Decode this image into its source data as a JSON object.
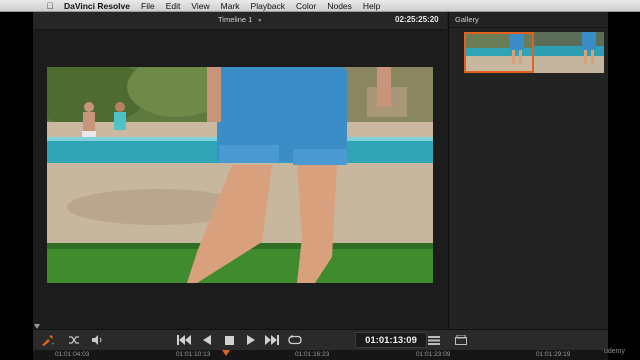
{
  "menubar": {
    "apple_icon": "apple-icon",
    "app_name": "DaVinci Resolve",
    "items": [
      "File",
      "Edit",
      "View",
      "Mark",
      "Playback",
      "Color",
      "Nodes",
      "Help"
    ]
  },
  "viewer": {
    "timeline_name": "Timeline 1",
    "timecode": "02:25:25:20"
  },
  "gallery": {
    "title": "Gallery",
    "stills": [
      {
        "name": "gallery-still-1",
        "selected": true
      },
      {
        "name": "gallery-still-2",
        "selected": false
      }
    ]
  },
  "transport": {
    "left_icons": [
      "picker-icon",
      "shuffle-icon",
      "volume-icon"
    ],
    "controls": [
      "skip-to-start-icon",
      "reverse-play-icon",
      "stop-icon",
      "play-icon",
      "skip-to-end-icon",
      "loop-icon"
    ],
    "current_timecode": "01:01:13:09",
    "right_icons": [
      "view-options-icon",
      "grab-still-icon"
    ]
  },
  "ruler": {
    "ticks": [
      "01:01:04:03",
      "01:01:10:13",
      "01:01:16:23",
      "01:01:23:09",
      "01:01:29:19"
    ]
  },
  "watermark": "udemy",
  "colors": {
    "accent": "#e0621c",
    "panel": "#1e1e1e"
  }
}
